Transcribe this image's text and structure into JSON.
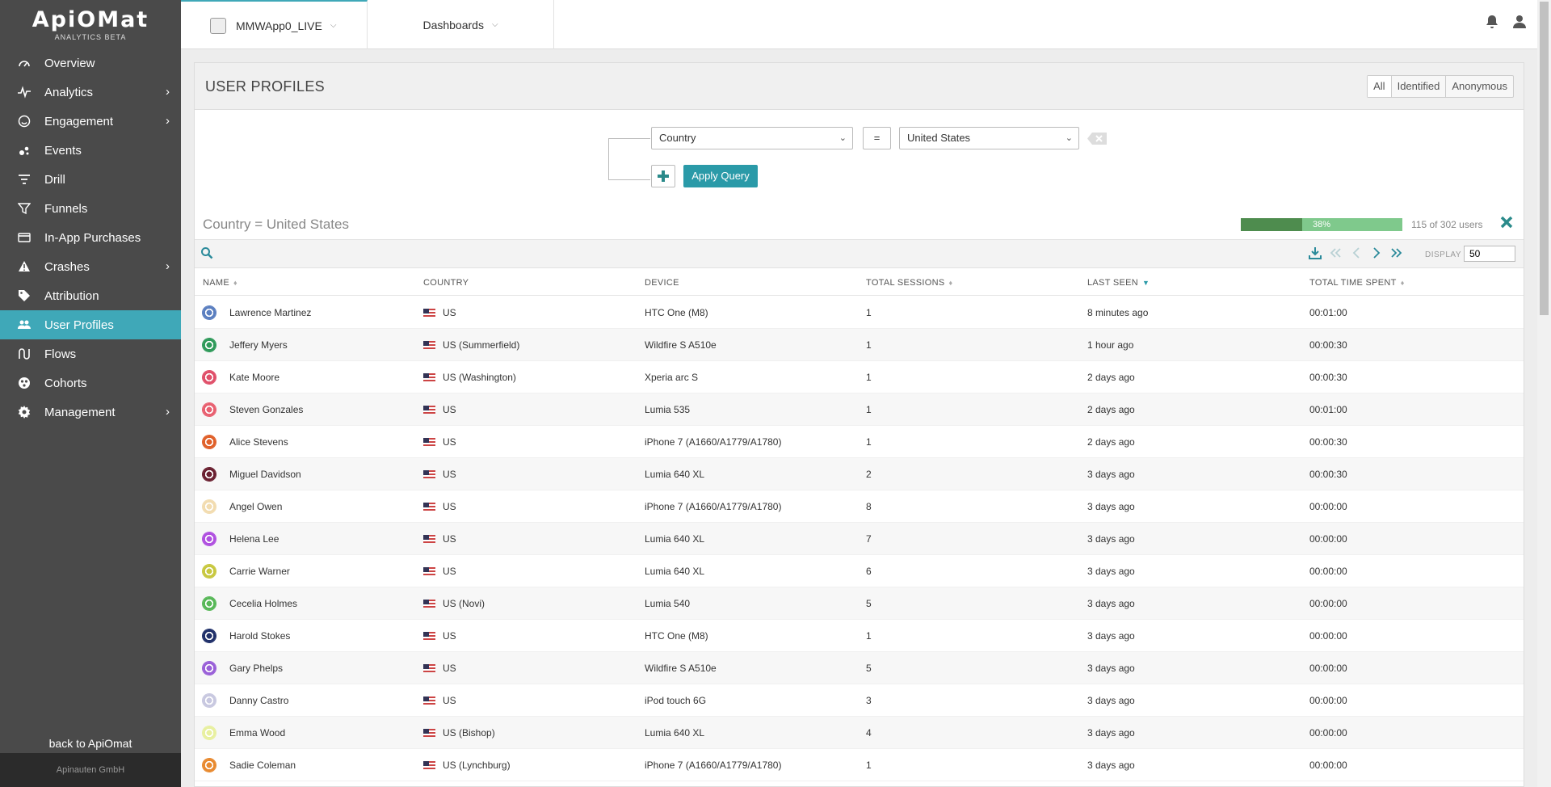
{
  "brand": {
    "logo": "ApiOMat",
    "subtitle": "ANALYTICS BETA",
    "footer": "Apinauten GmbH",
    "back": "back to ApiOmat"
  },
  "colors": {
    "accent": "#3fa8b8",
    "sidebar_bg": "#4a4a4a",
    "progress_fill": "#4e8c4e",
    "progress_bg": "#7fc98c"
  },
  "nav": [
    {
      "label": "Overview",
      "icon": "gauge-icon",
      "submenu": false
    },
    {
      "label": "Analytics",
      "icon": "pulse-icon",
      "submenu": true
    },
    {
      "label": "Engagement",
      "icon": "smile-icon",
      "submenu": true
    },
    {
      "label": "Events",
      "icon": "dots-icon",
      "submenu": false
    },
    {
      "label": "Drill",
      "icon": "filter-lines-icon",
      "submenu": false
    },
    {
      "label": "Funnels",
      "icon": "funnel-icon",
      "submenu": false
    },
    {
      "label": "In-App Purchases",
      "icon": "credit-card-icon",
      "submenu": false
    },
    {
      "label": "Crashes",
      "icon": "warning-icon",
      "submenu": true
    },
    {
      "label": "Attribution",
      "icon": "tag-icon",
      "submenu": false
    },
    {
      "label": "User Profiles",
      "icon": "users-icon",
      "submenu": false,
      "active": true
    },
    {
      "label": "Flows",
      "icon": "flow-icon",
      "submenu": false
    },
    {
      "label": "Cohorts",
      "icon": "cohorts-icon",
      "submenu": false
    },
    {
      "label": "Management",
      "icon": "gear-icon",
      "submenu": true
    }
  ],
  "topbar": {
    "app_name": "MMWApp0_LIVE",
    "dashboards": "Dashboards"
  },
  "panel": {
    "title": "USER PROFILES",
    "segments": [
      "All",
      "Identified",
      "Anonymous"
    ],
    "query": {
      "field": "Country",
      "operator": "=",
      "value": "United States",
      "apply": "Apply Query"
    },
    "filter_label": "Country = United States",
    "progress_percent": 38,
    "progress_text": "38%",
    "user_count": "115 of 302 users",
    "display_label": "DISPLAY",
    "display_value": "50"
  },
  "table": {
    "columns": [
      "NAME",
      "COUNTRY",
      "DEVICE",
      "TOTAL SESSIONS",
      "LAST SEEN",
      "TOTAL TIME SPENT"
    ],
    "rows": [
      {
        "name": "Lawrence Martinez",
        "country": "US",
        "device": "HTC One (M8)",
        "sessions": "1",
        "last_seen": "8 minutes ago",
        "time": "00:01:00",
        "avatar_color": "#5b7fc0"
      },
      {
        "name": "Jeffery Myers",
        "country": "US (Summerfield)",
        "device": "Wildfire S A510e",
        "sessions": "1",
        "last_seen": "1 hour ago",
        "time": "00:00:30",
        "avatar_color": "#2f9a5a"
      },
      {
        "name": "Kate Moore",
        "country": "US (Washington)",
        "device": "Xperia arc S",
        "sessions": "1",
        "last_seen": "2 days ago",
        "time": "00:00:30",
        "avatar_color": "#e0506a"
      },
      {
        "name": "Steven Gonzales",
        "country": "US",
        "device": "Lumia 535",
        "sessions": "1",
        "last_seen": "2 days ago",
        "time": "00:01:00",
        "avatar_color": "#e86070"
      },
      {
        "name": "Alice Stevens",
        "country": "US",
        "device": "iPhone 7 (A1660/A1779/A1780)",
        "sessions": "1",
        "last_seen": "2 days ago",
        "time": "00:00:30",
        "avatar_color": "#e0602a"
      },
      {
        "name": "Miguel Davidson",
        "country": "US",
        "device": "Lumia 640 XL",
        "sessions": "2",
        "last_seen": "3 days ago",
        "time": "00:00:30",
        "avatar_color": "#6a2030"
      },
      {
        "name": "Angel Owen",
        "country": "US",
        "device": "iPhone 7 (A1660/A1779/A1780)",
        "sessions": "8",
        "last_seen": "3 days ago",
        "time": "00:00:00",
        "avatar_color": "#f2dcb0"
      },
      {
        "name": "Helena Lee",
        "country": "US",
        "device": "Lumia 640 XL",
        "sessions": "7",
        "last_seen": "3 days ago",
        "time": "00:00:00",
        "avatar_color": "#b050e0"
      },
      {
        "name": "Carrie Warner",
        "country": "US",
        "device": "Lumia 640 XL",
        "sessions": "6",
        "last_seen": "3 days ago",
        "time": "00:00:00",
        "avatar_color": "#c8c840"
      },
      {
        "name": "Cecelia Holmes",
        "country": "US (Novi)",
        "device": "Lumia 540",
        "sessions": "5",
        "last_seen": "3 days ago",
        "time": "00:00:00",
        "avatar_color": "#58b858"
      },
      {
        "name": "Harold Stokes",
        "country": "US",
        "device": "HTC One (M8)",
        "sessions": "1",
        "last_seen": "3 days ago",
        "time": "00:00:00",
        "avatar_color": "#20306a"
      },
      {
        "name": "Gary Phelps",
        "country": "US",
        "device": "Wildfire S A510e",
        "sessions": "5",
        "last_seen": "3 days ago",
        "time": "00:00:00",
        "avatar_color": "#9a60d8"
      },
      {
        "name": "Danny Castro",
        "country": "US",
        "device": "iPod touch 6G",
        "sessions": "3",
        "last_seen": "3 days ago",
        "time": "00:00:00",
        "avatar_color": "#c8c8e0"
      },
      {
        "name": "Emma Wood",
        "country": "US (Bishop)",
        "device": "Lumia 640 XL",
        "sessions": "4",
        "last_seen": "3 days ago",
        "time": "00:00:00",
        "avatar_color": "#e8f0a0"
      },
      {
        "name": "Sadie Coleman",
        "country": "US (Lynchburg)",
        "device": "iPhone 7 (A1660/A1779/A1780)",
        "sessions": "1",
        "last_seen": "3 days ago",
        "time": "00:00:00",
        "avatar_color": "#e88a30"
      }
    ]
  }
}
